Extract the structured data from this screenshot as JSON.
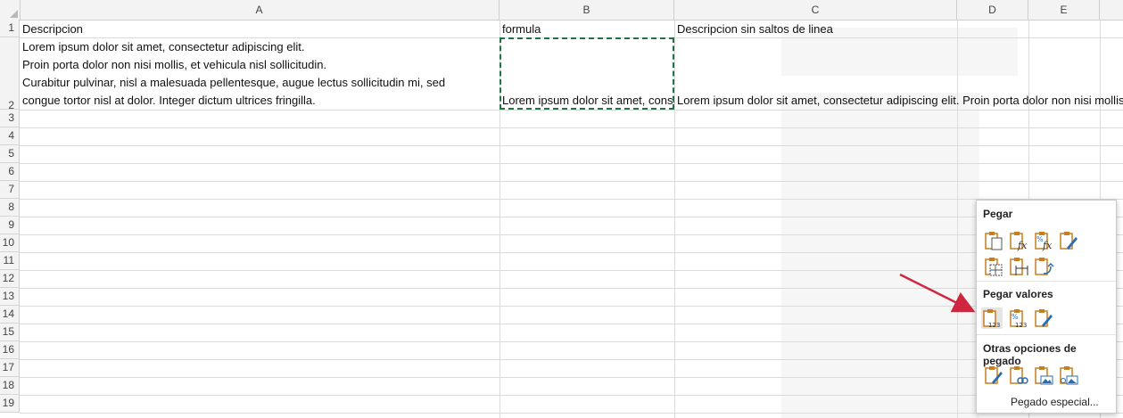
{
  "sheet": {
    "columns": [
      "A",
      "B",
      "C",
      "D",
      "E"
    ],
    "rows": [
      "1",
      "2",
      "3",
      "4",
      "5",
      "6",
      "7",
      "8",
      "9",
      "10",
      "11",
      "12",
      "13",
      "14",
      "15",
      "16",
      "17",
      "18",
      "19"
    ],
    "cells": {
      "A1": "Descripcion",
      "B1": "formula",
      "C1": "Descripcion sin saltos de linea",
      "A2_lines": [
        "Lorem ipsum dolor sit amet, consectetur adipiscing elit.",
        "Proin porta dolor non nisi mollis, et vehicula nisl sollicitudin.",
        "Curabitur pulvinar, nisl a malesuada pellentesque, augue lectus sollicitudin mi, sed",
        "congue tortor nisl at dolor. Integer dictum ultrices fringilla."
      ],
      "B2": "Lorem ipsum dolor sit amet, consectetur adipiscing elit.",
      "C2": "Lorem ipsum dolor sit amet, consectetur adipiscing elit. Proin porta dolor non nisi mollis"
    }
  },
  "paste_menu": {
    "section_paste": "Pegar",
    "section_values": "Pegar valores",
    "section_other": "Otras opciones de pegado",
    "special": "Pegado especial...",
    "paste_icons": [
      "paste-icon",
      "paste-formulas-icon",
      "paste-formulas-number-format-icon",
      "paste-keep-source-formatting-icon",
      "paste-no-borders-icon",
      "paste-keep-column-widths-icon",
      "paste-transpose-icon"
    ],
    "value_icons": [
      "paste-values-icon",
      "paste-values-number-format-icon",
      "paste-values-source-formatting-icon"
    ],
    "other_icons": [
      "paste-formatting-icon",
      "paste-link-icon",
      "paste-picture-icon",
      "paste-linked-picture-icon"
    ]
  },
  "colors": {
    "accent": "#217346",
    "arrow": "#d0263f",
    "icon_orange": "#c87d1e",
    "icon_blue": "#2b6cb0"
  }
}
